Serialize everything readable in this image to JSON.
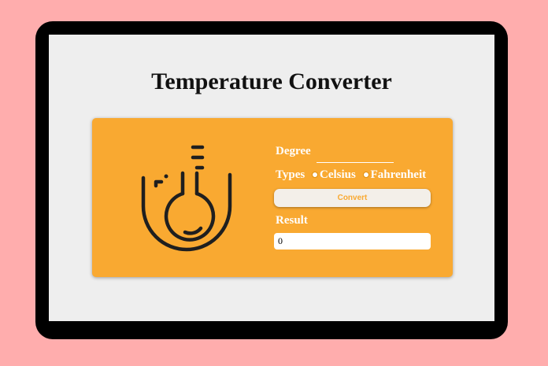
{
  "page": {
    "title": "Temperature Converter"
  },
  "form": {
    "degree_label": "Degree",
    "degree_value": "",
    "types_label": "Types",
    "options": [
      "Celsius",
      "Fahrenheit"
    ],
    "convert_label": "Convert",
    "result_label": "Result",
    "result_value": "0"
  },
  "icons": {
    "thermometer": "thermometer-icon"
  },
  "colors": {
    "background": "#ffadad",
    "card": "#f9a931",
    "screen": "#eeeeee"
  }
}
